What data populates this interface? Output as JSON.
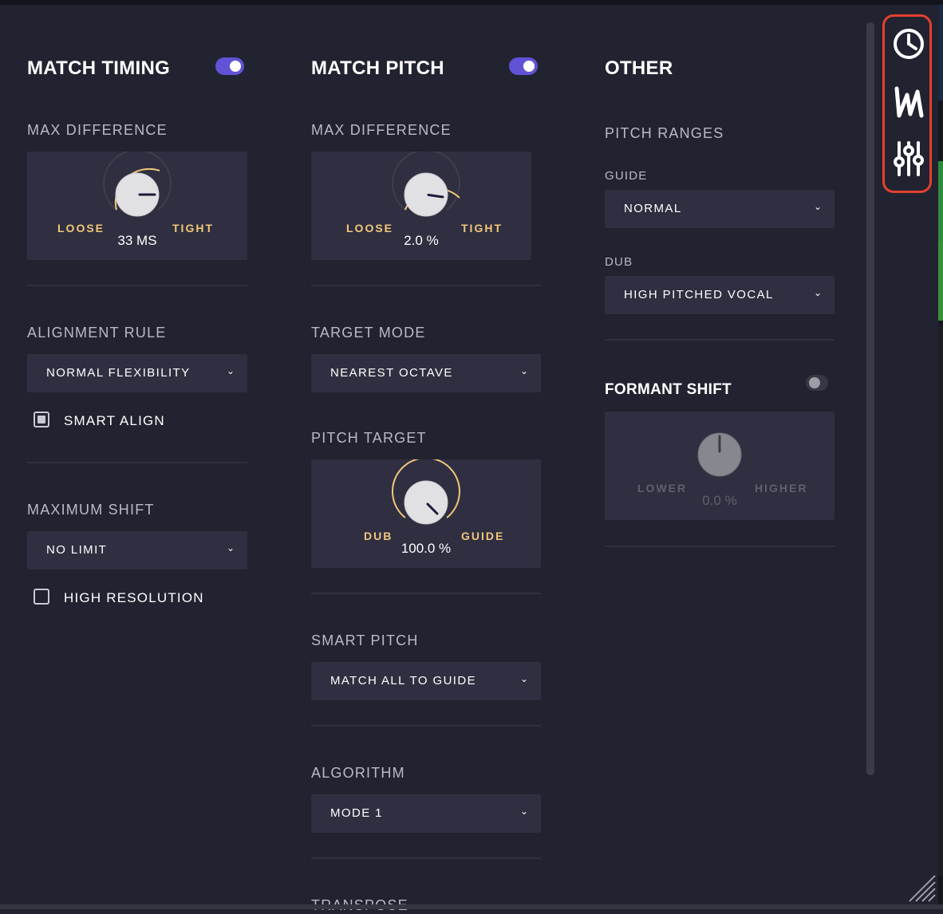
{
  "match_timing": {
    "title": "MATCH TIMING",
    "enabled": true,
    "max_difference": {
      "label": "MAX DIFFERENCE",
      "left": "LOOSE",
      "right": "TIGHT",
      "value": "33 MS"
    },
    "alignment_rule": {
      "label": "ALIGNMENT RULE",
      "selected": "NORMAL FLEXIBILITY"
    },
    "smart_align": {
      "label": "SMART ALIGN",
      "checked": true
    },
    "maximum_shift": {
      "label": "MAXIMUM SHIFT",
      "selected": "NO LIMIT"
    },
    "high_resolution": {
      "label": "HIGH RESOLUTION",
      "checked": false
    }
  },
  "match_pitch": {
    "title": "MATCH PITCH",
    "enabled": true,
    "max_difference": {
      "label": "MAX DIFFERENCE",
      "left": "LOOSE",
      "right": "TIGHT",
      "value": "2.0 %"
    },
    "target_mode": {
      "label": "TARGET MODE",
      "selected": "NEAREST OCTAVE"
    },
    "pitch_target": {
      "label": "PITCH TARGET",
      "left": "DUB",
      "right": "GUIDE",
      "value": "100.0 %"
    },
    "smart_pitch": {
      "label": "SMART PITCH",
      "selected": "MATCH ALL TO GUIDE"
    },
    "algorithm": {
      "label": "ALGORITHM",
      "selected": "MODE 1"
    },
    "transpose": {
      "label": "TRANSPOSE"
    }
  },
  "other": {
    "title": "OTHER",
    "pitch_ranges": {
      "label": "PITCH RANGES",
      "guide": {
        "label": "GUIDE",
        "selected": "NORMAL"
      },
      "dub": {
        "label": "DUB",
        "selected": "HIGH PITCHED VOCAL"
      }
    },
    "formant_shift": {
      "label": "FORMANT SHIFT",
      "enabled": false,
      "left": "LOWER",
      "right": "HIGHER",
      "value": "0.0 %"
    }
  },
  "side_panel": {
    "icons": [
      "clock-icon",
      "m-logo-icon",
      "sliders-icon"
    ]
  },
  "colors": {
    "accent": "#6152d6",
    "knob_arc": "#f2c77a",
    "panel": "#2f2f41",
    "background": "#222330",
    "highlight": "#e3412f"
  },
  "dropdown_chevron": "⌄"
}
